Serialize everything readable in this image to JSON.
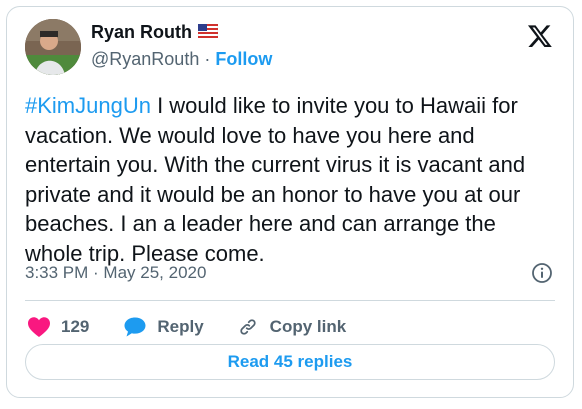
{
  "author": {
    "name": "Ryan Routh",
    "handle": "@RyanRouth",
    "separator": "·",
    "follow_label": "Follow",
    "flag_icon": "us-flag-icon"
  },
  "tweet": {
    "hashtag": "#KimJungUn",
    "text": " I would like to invite you to Hawaii for\nvacation.  We would love to have you here and\nentertain you.  With the current virus it is vacant and\nprivate and it would be an honor to have you at our\nbeaches.  I an a leader here and can arrange the\nwhole trip.  Please come.",
    "timestamp": "3:33 PM · May 25, 2020"
  },
  "actions": {
    "like_count": "129",
    "reply_label": "Reply",
    "copy_link_label": "Copy link",
    "read_replies_label": "Read 45 replies"
  },
  "colors": {
    "accent": "#1d9bf0",
    "like": "#f91880",
    "secondary_text": "#536471",
    "border": "#cfd9de"
  },
  "icons": {
    "logo": "x-logo-icon",
    "info": "info-icon",
    "like": "heart-icon",
    "reply": "speech-bubble-icon",
    "copy_link": "link-icon"
  }
}
